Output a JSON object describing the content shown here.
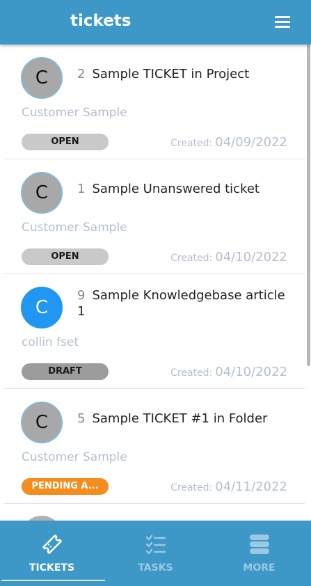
{
  "header": {
    "title": "tickets",
    "menu_icon": "hamburger-icon"
  },
  "tickets": [
    {
      "avatar_letter": "C",
      "avatar_color": "#a8a8a8",
      "number": "2",
      "title": "Sample TICKET in Project",
      "customer": "Customer Sample",
      "status": "OPEN",
      "status_color": "#c9c9c9",
      "created_label": "Created:",
      "created_date": "04/09/2022"
    },
    {
      "avatar_letter": "C",
      "avatar_color": "#a8a8a8",
      "number": "1",
      "title": "Sample Unanswered ticket",
      "customer": "Customer Sample",
      "status": "OPEN",
      "status_color": "#c9c9c9",
      "created_label": "Created:",
      "created_date": "04/10/2022"
    },
    {
      "avatar_letter": "C",
      "avatar_color": "#2196f3",
      "number": "9",
      "title": "Sample Knowledgebase article 1",
      "customer": "collin fset",
      "status": "DRAFT",
      "status_color": "#9c9c9c",
      "created_label": "Created:",
      "created_date": "04/10/2022"
    },
    {
      "avatar_letter": "C",
      "avatar_color": "#a8a8a8",
      "number": "5",
      "title": "Sample TICKET #1 in Folder",
      "customer": "Customer Sample",
      "status": "PENDING A...",
      "status_color": "#f58c1e",
      "created_label": "Created:",
      "created_date": "04/11/2022"
    }
  ],
  "tabbar": {
    "tabs": [
      {
        "label": "TICKETS",
        "icon": "ticket-icon",
        "active": true
      },
      {
        "label": "TASKS",
        "icon": "checklist-icon",
        "active": false
      },
      {
        "label": "MORE",
        "icon": "stack-icon",
        "active": false
      }
    ]
  },
  "colors": {
    "header": "#3d98c7",
    "muted_text": "#b5bfcf",
    "accent_blue": "#2196f3",
    "pending": "#f58c1e"
  }
}
